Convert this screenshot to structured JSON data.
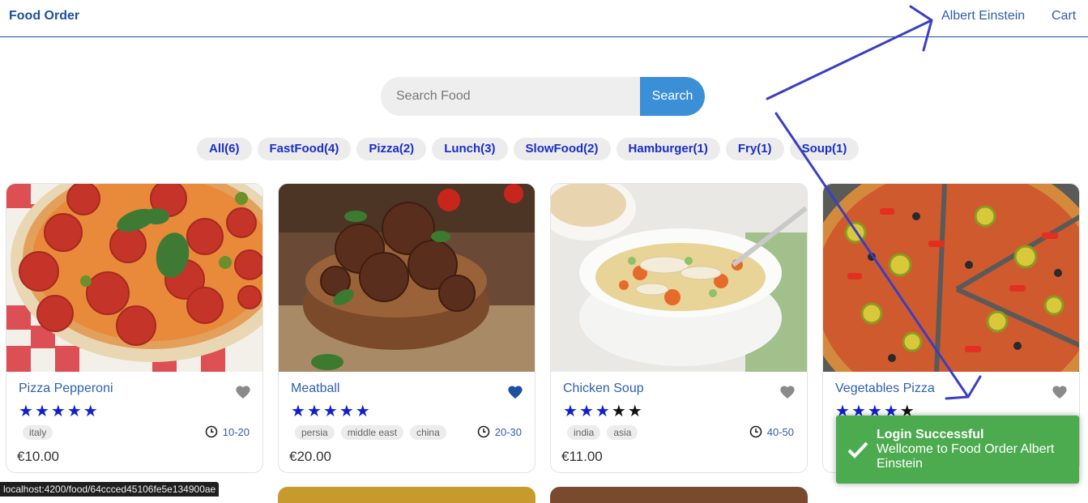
{
  "header": {
    "brand": "Food Order",
    "user": "Albert Einstein",
    "cart": "Cart"
  },
  "search": {
    "placeholder": "Search Food",
    "button": "Search"
  },
  "tags": [
    "All(6)",
    "FastFood(4)",
    "Pizza(2)",
    "Lunch(3)",
    "SlowFood(2)",
    "Hamburger(1)",
    "Fry(1)",
    "Soup(1)"
  ],
  "foods": [
    {
      "name": "Pizza Pepperoni",
      "stars": 5,
      "favorite": false,
      "origins": [
        "italy"
      ],
      "cook_time": "10-20",
      "price": "€10.00"
    },
    {
      "name": "Meatball",
      "stars": 5,
      "favorite": true,
      "origins": [
        "persia",
        "middle east",
        "china"
      ],
      "cook_time": "20-30",
      "price": "€20.00"
    },
    {
      "name": "Chicken Soup",
      "stars": 3,
      "favorite": false,
      "origins": [
        "india",
        "asia"
      ],
      "cook_time": "40-50",
      "price": "€11.00"
    },
    {
      "name": "Vegetables Pizza",
      "stars": 4,
      "favorite": false,
      "origins": [],
      "cook_time": "",
      "price": ""
    }
  ],
  "toast": {
    "title": "Login Successful",
    "message": "Wellcome to Food Order Albert Einstein"
  },
  "status_url": "localhost:4200/food/64ccced45106fe5e134900ae",
  "colors": {
    "brand": "#1e4fa0",
    "search_button": "#3b8fd6",
    "tag_text": "#1a2ec8",
    "star": "#1020cc",
    "favorite_on": "#1e4fa0",
    "favorite_off": "#8a8a8a",
    "toast": "#4caa4f",
    "annotation_arrow": "#3a3fc0"
  }
}
